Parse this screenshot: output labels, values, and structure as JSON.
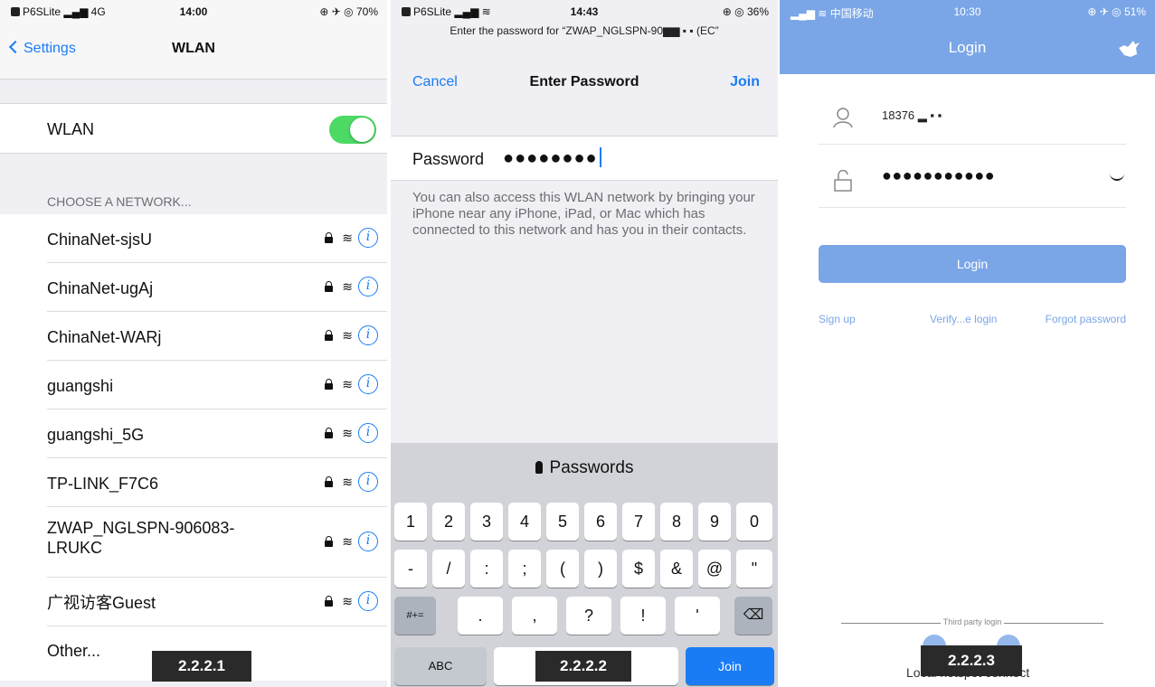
{
  "panel1": {
    "status": {
      "carrier": "P6SLite",
      "signal": "▂▄▆ 4G",
      "time": "14:00",
      "right": "⊕ ✈ ◎ 70%"
    },
    "nav": {
      "back_label": "Settings",
      "title": "WLAN"
    },
    "wlan_label": "WLAN",
    "section_header": "CHOOSE A NETWORK...",
    "networks": [
      {
        "name": "ChinaNet-sjsU"
      },
      {
        "name": "ChinaNet-ugAj"
      },
      {
        "name": "ChinaNet-WARj"
      },
      {
        "name": "guangshi"
      },
      {
        "name": "guangshi_5G"
      },
      {
        "name": "TP-LINK_F7C6"
      },
      {
        "name": "ZWAP_NGLSPN-906083-LRUKC"
      },
      {
        "name": "广视访客Guest"
      }
    ],
    "other_label": "Other...",
    "figure_label": "2.2.2.1"
  },
  "panel2": {
    "status": {
      "carrier": "P6SLite",
      "signal": "▂▄▆ ≋",
      "time": "14:43",
      "right": "⊕ ◎ 36%"
    },
    "top_message": "Enter the password for “ZWAP_NGLSPN-90▆▆ ▪ ▪ (EC”",
    "nav": {
      "cancel": "Cancel",
      "title": "Enter Password",
      "join": "Join"
    },
    "password_label": "Password",
    "password_mask": "●●●●●●●●",
    "hint": "You can also access this WLAN network by bringing your iPhone near any iPhone, iPad, or Mac which has connected to this network and has you in their contacts.",
    "keyboard": {
      "suggestion": "Passwords",
      "row1": [
        "1",
        "2",
        "3",
        "4",
        "5",
        "6",
        "7",
        "8",
        "9",
        "0"
      ],
      "row2": [
        "-",
        "/",
        ":",
        ";",
        "(",
        ")",
        "$",
        "&",
        "@",
        "\""
      ],
      "row3_left": "#+=",
      "row3": [
        ".",
        ",",
        "?",
        "!",
        "'"
      ],
      "backspace": "⌫",
      "abc": "ABC",
      "join": "Join"
    },
    "figure_label": "2.2.2.2"
  },
  "panel3": {
    "status": {
      "carrier": "中国移动",
      "signal": "▂▄▆ ≋",
      "time": "10:30",
      "right": "⊕ ✈ ◎ 51%"
    },
    "title": "Login",
    "username": "18376 ▂ ▪ ▪",
    "password_mask": "●●●●●●●●●●●",
    "login_button": "Login",
    "links": {
      "signup": "Sign up",
      "verify": "Verify...e login",
      "forgot": "Forgot password"
    },
    "third_party": "Third party login",
    "hotspot_connect": "Local hotspot connect",
    "figure_label": "2.2.2.3"
  },
  "colors": {
    "ios_blue": "#1a7cf5",
    "toggle_green": "#4cd964",
    "app_blue": "#7aa6e7"
  }
}
